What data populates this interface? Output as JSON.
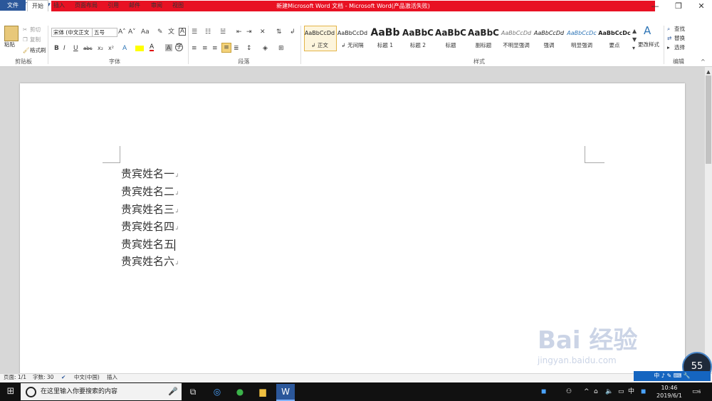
{
  "window": {
    "title": "新建Microsoft Word 文档 - Microsoft Word(产品激活失败)",
    "quick_access": [
      "W",
      "💾",
      "↶",
      "↻",
      "▾"
    ],
    "controls": [
      "—",
      "❐",
      "✕"
    ]
  },
  "tabs": [
    "文件",
    "开始",
    "插入",
    "页面布局",
    "引用",
    "邮件",
    "审阅",
    "视图"
  ],
  "clipboard": {
    "paste": "粘贴",
    "cut": "剪切",
    "copy": "复制",
    "format_painter": "格式刷",
    "group": "剪贴板"
  },
  "font": {
    "name": "宋体 (中文正文",
    "size": "五号",
    "group": "字体",
    "buttons": [
      "B",
      "I",
      "U",
      "abc",
      "x₂",
      "x²"
    ]
  },
  "paragraph": {
    "group": "段落"
  },
  "styles": {
    "group": "样式",
    "items": [
      {
        "preview": "AaBbCcDd",
        "name": "↲ 正文"
      },
      {
        "preview": "AaBbCcDd",
        "name": "↲ 无间隔"
      },
      {
        "preview": "AaBb",
        "name": "标题 1"
      },
      {
        "preview": "AaBbC",
        "name": "标题 2"
      },
      {
        "preview": "AaBbC",
        "name": "标题"
      },
      {
        "preview": "AaBbC",
        "name": "副标题"
      },
      {
        "preview": "AaBbCcDd",
        "name": "不明显强调"
      },
      {
        "preview": "AaBbCcDd",
        "name": "强调"
      },
      {
        "preview": "AaBbCcDc",
        "name": "明显强调"
      },
      {
        "preview": "AaBbCcDc",
        "name": "要点"
      }
    ],
    "change_styles": "更改样式"
  },
  "editing": {
    "group": "编辑",
    "find": "查找",
    "replace": "替换",
    "select": "选择"
  },
  "document": {
    "lines": [
      "贵宾姓名一",
      "贵宾姓名二",
      "贵宾姓名三",
      "贵宾姓名四",
      "贵宾姓名五",
      "贵宾姓名六"
    ]
  },
  "status": {
    "page": "页面: 1/1",
    "words": "字数: 30",
    "language": "中文(中国)",
    "mode": "插入"
  },
  "taskbar": {
    "search_placeholder": "在这里输入你要搜索的内容",
    "time": "10:46",
    "date": "2019/6/1",
    "ime": "中",
    "notifications": "6"
  },
  "overlay": {
    "meter": "55",
    "watermark": "Bai 经验",
    "watermark_url": "jingyan.baidu.com"
  }
}
